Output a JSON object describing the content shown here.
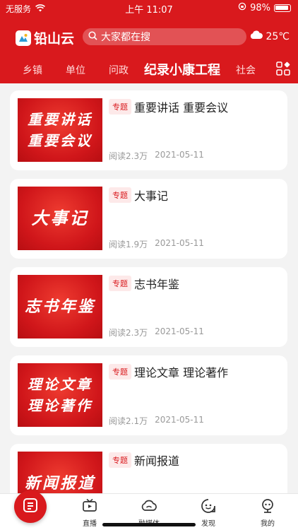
{
  "status_bar": {
    "carrier": "无服务",
    "time": "上午 11:07",
    "battery": "98%"
  },
  "header": {
    "app_name": "铅山云",
    "search_placeholder": "大家都在搜",
    "weather": "25℃"
  },
  "tabs": [
    {
      "label": "乡镇",
      "active": false
    },
    {
      "label": "单位",
      "active": false
    },
    {
      "label": "问政",
      "active": false
    },
    {
      "label": "纪录小康工程",
      "active": true
    },
    {
      "label": "社会",
      "active": false
    }
  ],
  "articles": [
    {
      "thumb_lines": [
        "重要讲话",
        "重要会议"
      ],
      "tag": "专题",
      "title": "重要讲话  重要会议",
      "reads": "阅读2.3万",
      "date": "2021-05-11"
    },
    {
      "thumb_lines": [
        "大事记"
      ],
      "tag": "专题",
      "title": "大事记",
      "reads": "阅读1.9万",
      "date": "2021-05-11"
    },
    {
      "thumb_lines": [
        "志书年鉴"
      ],
      "tag": "专题",
      "title": "志书年鉴",
      "reads": "阅读2.3万",
      "date": "2021-05-11"
    },
    {
      "thumb_lines": [
        "理论文章",
        "理论著作"
      ],
      "tag": "专题",
      "title": "理论文章  理论著作",
      "reads": "阅读2.1万",
      "date": "2021-05-11"
    },
    {
      "thumb_lines": [
        "新闻报道"
      ],
      "tag": "专题",
      "title": "新闻报道",
      "reads": "",
      "date": ""
    }
  ],
  "bottom_nav": [
    {
      "label": "直播",
      "icon": "tv-icon"
    },
    {
      "label": "融媒体",
      "icon": "cloud-icon"
    },
    {
      "label": "发现",
      "icon": "discover-icon"
    },
    {
      "label": "我的",
      "icon": "profile-icon"
    }
  ],
  "colors": {
    "brand_red": "#d9191d"
  }
}
